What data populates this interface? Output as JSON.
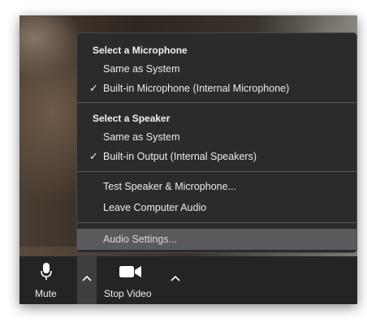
{
  "menu": {
    "microphone_header": "Select a Microphone",
    "microphone_items": [
      {
        "label": "Same as System",
        "checked": false
      },
      {
        "label": "Built-in Microphone (Internal Microphone)",
        "checked": true
      }
    ],
    "speaker_header": "Select a Speaker",
    "speaker_items": [
      {
        "label": "Same as System",
        "checked": false
      },
      {
        "label": "Built-in Output (Internal Speakers)",
        "checked": true
      }
    ],
    "test_label": "Test Speaker & Microphone...",
    "leave_label": "Leave Computer Audio",
    "settings_label": "Audio Settings...",
    "check_glyph": "✓"
  },
  "toolbar": {
    "mute_label": "Mute",
    "stop_video_label": "Stop Video"
  },
  "colors": {
    "menu_bg": "#2b2b2d",
    "highlight": "#5a5a5c",
    "toolbar_bg": "#242424"
  }
}
